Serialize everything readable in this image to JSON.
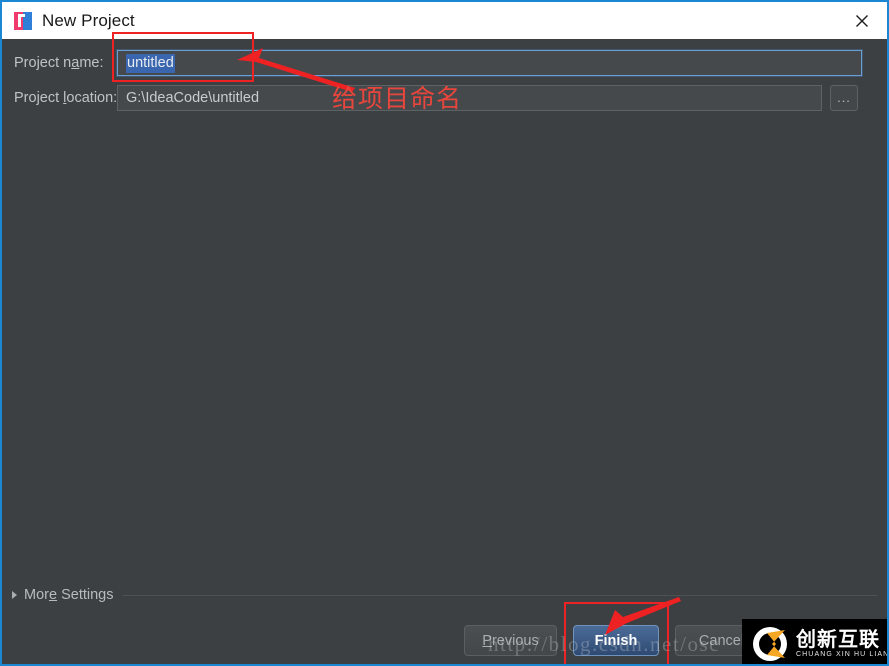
{
  "window": {
    "title": "New Project",
    "app_icon": "intellij-idea-icon",
    "close_icon": "close-icon",
    "border_color": "#1b87d3",
    "background_color": "#3c4043"
  },
  "form": {
    "project_name": {
      "label_pre": "Project n",
      "label_mnemonic": "a",
      "label_post": "me:",
      "value": "untitled",
      "selected": true,
      "selection_color": "#3a66b0"
    },
    "project_location": {
      "label_pre": "Project ",
      "label_mnemonic": "l",
      "label_post": "ocation:",
      "value": "G:\\IdeaCode\\untitled"
    },
    "browse_button_label": "..."
  },
  "more_settings": {
    "label_pre": "Mor",
    "label_mnemonic": "e",
    "label_post": " Settings",
    "expander_icon": "triangle-right-icon",
    "expanded": false
  },
  "buttons": {
    "previous": {
      "label_pre": "",
      "label_mnemonic": "P",
      "label_post": "revious"
    },
    "finish": {
      "label": "Finish",
      "is_default": true,
      "accent_color": "#3f5f8c"
    },
    "cancel": {
      "label": "Cancel"
    }
  },
  "annotations": {
    "color": "#ee2222",
    "name_note": "给项目命名",
    "highlight_name_field": true,
    "highlight_finish_button": true
  },
  "watermarks": {
    "url": "http://blog.csdn.net/osc",
    "logo_cn": "创新互联",
    "logo_pinyin": "CHUANG XIN HU LIAN",
    "logo_accent_color": "#f5a623"
  }
}
